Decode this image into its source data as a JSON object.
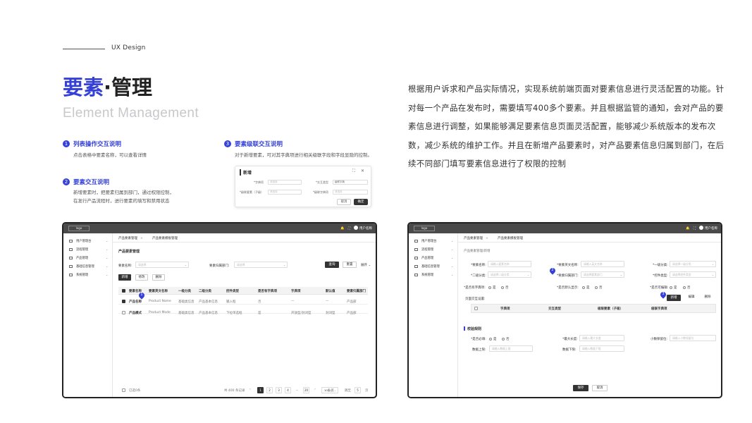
{
  "header": {
    "ux_label": "UX Design",
    "title_accent": "要素",
    "title_dot": "·",
    "title_rest": "管理",
    "subtitle": "Element Management"
  },
  "description": "根据用户诉求和产品实际情况，实现系统前端页面对要素信息进行灵活配置的功能。针对每一个产品在发布时，需要填写400多个要素。并且根据监管的通知，会对产品的要素信息进行调整，如果能够满足要素信息页面灵活配置，能够减少系统版本的发布次数，减少系统的维护工作。并且在新增产品要素时，对产品要素信息归属到部门，在后续不同部门填写要素信息进行了权限的控制",
  "notes": [
    {
      "num": "1",
      "title": "列表操作交互说明",
      "lines": [
        "点击表格中要素名称，可以查看详情"
      ]
    },
    {
      "num": "2",
      "title": "要素交互说明",
      "lines": [
        "新增要素时，把要素归属到部门，通过权限控制，",
        "在发行产品流程时，进行要素的填写和禁用状态"
      ]
    },
    {
      "num": "3",
      "title": "要素级联交互说明",
      "lines": [
        "对于新增要素，可对其字典项进行相关级联字段和字段显隐的控制。"
      ]
    }
  ],
  "dialog": {
    "title": "新增",
    "icons": "⛶ ✕",
    "f1_label": "*字典项",
    "f1_ph": "请选择",
    "f2_label": "*交互类型",
    "f2_val": "级联字典",
    "f3_label": "*级联要素（子级）",
    "f3_ph": "请选择",
    "f4_label": "*级联字典项",
    "f4_ph": "请选择",
    "cancel": "取消",
    "ok": "确定"
  },
  "app": {
    "logo": "logo",
    "user": "用户名称",
    "menu": [
      "用户管理台",
      "流程管理",
      "产品管理",
      "基础信息管理",
      "系统管理"
    ],
    "left": {
      "tab1": "产品要素管理",
      "tab2": "产品要素模板管理",
      "section": "产品要素管理",
      "f_name_label": "要素名称:",
      "f_name_ph": "请选择",
      "f_dept_label": "要素归属部门:",
      "f_dept_ph": "请选择",
      "search": "查询",
      "reset": "重置",
      "expand": "展开",
      "add": "新增",
      "edit": "修改",
      "del": "删除",
      "columns": [
        "要素名称",
        "要素英文名称",
        "一级分类",
        "二级分类",
        "控件类型",
        "是否有字典项",
        "字典项",
        "默认值",
        "要素归属部门"
      ],
      "rows": [
        [
          "产品名称",
          "Product Name",
          "基础类信息",
          "产品基本信息",
          "输入框",
          "否",
          "—",
          "—",
          "产品部"
        ],
        [
          "产品模式",
          "Product Mode",
          "基础类信息",
          "产品基本信息",
          "下拉单选框",
          "是",
          "开放型/封闭型",
          "封闭型",
          "产品部"
        ]
      ],
      "selected": "已选0条",
      "total": "共 400 条记录",
      "pages": [
        "1",
        "2",
        "3",
        "4",
        "…",
        "20"
      ],
      "per_page": "10条/页",
      "jump": "跳至",
      "jump_val": "5",
      "page_unit": "页"
    },
    "right": {
      "tab1": "产品要素管理",
      "tab2": "产品要素模板管理",
      "breadcrumb": "产品要素管理/新增",
      "r1": [
        [
          "*要素名称:",
          "请输入要素名称"
        ],
        [
          "*要素英文名称:",
          "请输入英文名称"
        ],
        [
          "*一级分类:",
          "请选择一级分类"
        ]
      ],
      "r2": [
        [
          "*二级分类:",
          "请选择二级分类"
        ],
        [
          "*要素归属部门:",
          "请选择要素部门"
        ],
        [
          "*控件类型:",
          "请选择控件类型"
        ]
      ],
      "r3a": "*是否有字典项:",
      "r3b": "*是否默认显示:",
      "r3c": "*是否可编辑:",
      "yes": "是",
      "no": "否",
      "config_label": "页面交互设置:",
      "add": "新增",
      "edit": "编辑",
      "del": "删除",
      "cols": [
        "字典项",
        "交互类型",
        "级联要素（子级）",
        "级联字典项"
      ],
      "validate": "校验规则",
      "v1": "*是否必填:",
      "v2": "*最大长度:",
      "v2_ph": "请输入最大长度",
      "v3": "小数保留位:",
      "v3_ph": "请输入小数保留位",
      "v4": "数据上限:",
      "v4_ph": "请输入数据上限",
      "v5": "数据下限:",
      "v5_ph": "请输入数据下限",
      "save": "保存",
      "cancel": "取消"
    }
  },
  "colors": {
    "accent": "#3440d8",
    "dark": "#333333",
    "topbar": "#4a4a4a"
  }
}
